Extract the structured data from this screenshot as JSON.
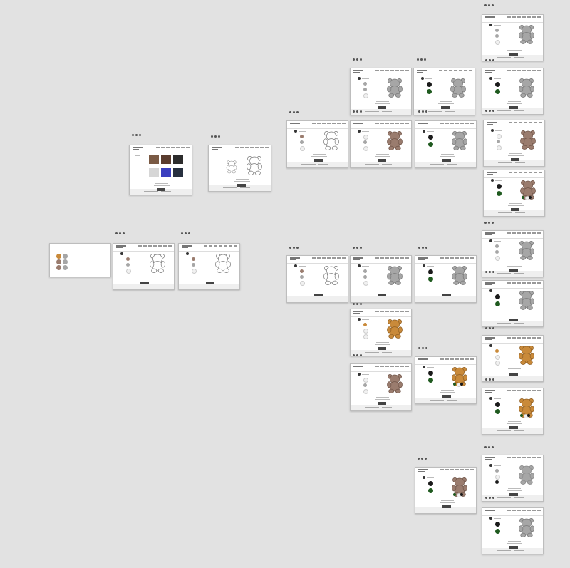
{
  "canvas": {
    "background": "#e2e2e2",
    "name": "design-canvas"
  },
  "palette": {
    "gray": "#a6a6a6",
    "brown": "#9a7c6e",
    "black": "#1a1a1a",
    "green": "#1f5a1f",
    "orange": "#c98a3a",
    "white": "#f1f1f1",
    "button": "#444444",
    "outline": "#777777"
  },
  "frames": [
    {
      "id": "f-swatches",
      "variant": "swatches-only"
    },
    {
      "id": "f-outline-1",
      "variant": "outline"
    },
    {
      "id": "f-outline-2",
      "variant": "outline"
    },
    {
      "id": "f-catalog",
      "variant": "catalog"
    },
    {
      "id": "f-outline-small",
      "variant": "outline-twin"
    },
    {
      "id": "f-r1-outline",
      "variant": "outline"
    },
    {
      "id": "f-r1-gray",
      "variant": "gray"
    },
    {
      "id": "f-r1-green",
      "variant": "green"
    },
    {
      "id": "f-r2-brown",
      "variant": "brown"
    },
    {
      "id": "f-r2-green",
      "variant": "green-gray"
    },
    {
      "id": "f-col-gray",
      "variant": "gray"
    },
    {
      "id": "f-col-green",
      "variant": "green-gray"
    },
    {
      "id": "f-col-brown",
      "variant": "brown"
    },
    {
      "id": "f-col-brown-green",
      "variant": "brown-green"
    },
    {
      "id": "f-b-outline",
      "variant": "outline"
    },
    {
      "id": "f-b-gray",
      "variant": "gray"
    },
    {
      "id": "f-b-green",
      "variant": "green"
    },
    {
      "id": "f-b-orange",
      "variant": "orange"
    },
    {
      "id": "f-b-brown",
      "variant": "brown"
    },
    {
      "id": "f-b-orange-green",
      "variant": "orange-green"
    },
    {
      "id": "f-c2-gray",
      "variant": "gray"
    },
    {
      "id": "f-c2-green",
      "variant": "green-gray"
    },
    {
      "id": "f-c2-orange",
      "variant": "orange"
    },
    {
      "id": "f-c2-orange-green",
      "variant": "orange-green"
    },
    {
      "id": "f-d-brown",
      "variant": "brown-green"
    },
    {
      "id": "f-d-gray",
      "variant": "gray-light"
    },
    {
      "id": "f-d-green",
      "variant": "green-gray"
    }
  ],
  "icons": {
    "frame_menu": "more-dots-icon"
  }
}
